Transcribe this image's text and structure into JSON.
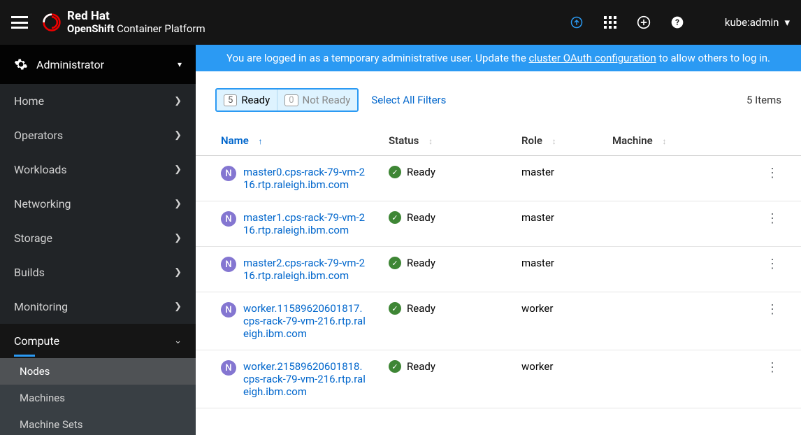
{
  "header": {
    "brand_line1": "Red Hat",
    "brand_line2_bold": "OpenShift",
    "brand_line2_light": " Container Platform",
    "user": "kube:admin"
  },
  "sidebar": {
    "perspective": "Administrator",
    "items": [
      {
        "label": "Home",
        "expanded": false
      },
      {
        "label": "Operators",
        "expanded": false
      },
      {
        "label": "Workloads",
        "expanded": false
      },
      {
        "label": "Networking",
        "expanded": false
      },
      {
        "label": "Storage",
        "expanded": false
      },
      {
        "label": "Builds",
        "expanded": false
      },
      {
        "label": "Monitoring",
        "expanded": false
      }
    ],
    "compute": {
      "label": "Compute",
      "children": [
        {
          "label": "Nodes",
          "active": true
        },
        {
          "label": "Machines",
          "active": false
        },
        {
          "label": "Machine Sets",
          "active": false
        }
      ]
    }
  },
  "banner": {
    "prefix": "You are logged in as a temporary administrative user. Update the ",
    "link": "cluster OAuth configuration",
    "suffix": " to allow others to log in."
  },
  "filters": {
    "ready_count": "5",
    "ready_label": "Ready",
    "notready_count": "0",
    "notready_label": "Not Ready",
    "select_all": "Select All Filters",
    "total": "5 Items"
  },
  "columns": {
    "name": "Name",
    "status": "Status",
    "role": "Role",
    "machine": "Machine"
  },
  "rows": [
    {
      "name": "master0.cps-rack-79-vm-216.rtp.raleigh.ibm.com",
      "status": "Ready",
      "role": "master",
      "machine": ""
    },
    {
      "name": "master1.cps-rack-79-vm-216.rtp.raleigh.ibm.com",
      "status": "Ready",
      "role": "master",
      "machine": ""
    },
    {
      "name": "master2.cps-rack-79-vm-216.rtp.raleigh.ibm.com",
      "status": "Ready",
      "role": "master",
      "machine": ""
    },
    {
      "name": "worker.11589620601817.cps-rack-79-vm-216.rtp.raleigh.ibm.com",
      "status": "Ready",
      "role": "worker",
      "machine": ""
    },
    {
      "name": "worker.21589620601818.cps-rack-79-vm-216.rtp.raleigh.ibm.com",
      "status": "Ready",
      "role": "worker",
      "machine": ""
    }
  ]
}
